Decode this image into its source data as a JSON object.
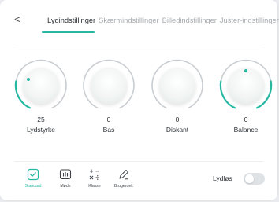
{
  "header": {
    "back_glyph": "<",
    "tabs": [
      {
        "label": "Lydindstillinger",
        "active": true
      },
      {
        "label": "Skærmindstillinger",
        "active": false
      },
      {
        "label": "Billedindstillinger",
        "active": false
      },
      {
        "label": "Juster-indstillinger",
        "active": false
      }
    ]
  },
  "knobs": [
    {
      "label": "Lydstyrke",
      "value": "25"
    },
    {
      "label": "Bas",
      "value": "0"
    },
    {
      "label": "Diskant",
      "value": "0"
    },
    {
      "label": "Balance",
      "value": "0"
    }
  ],
  "modes": [
    {
      "label": "Standard",
      "icon": "standard-icon",
      "active": true
    },
    {
      "label": "Møde",
      "icon": "meeting-icon",
      "active": false
    },
    {
      "label": "Klasse",
      "icon": "class-icon",
      "active": false
    },
    {
      "label": "Brugerdef.",
      "icon": "custom-icon",
      "active": false
    }
  ],
  "mute": {
    "label": "Lydløs",
    "on": false
  },
  "colors": {
    "accent": "#25b9a3",
    "track": "#c9cdd1",
    "text": "#2d3135",
    "muted_text": "#a7abb0"
  }
}
